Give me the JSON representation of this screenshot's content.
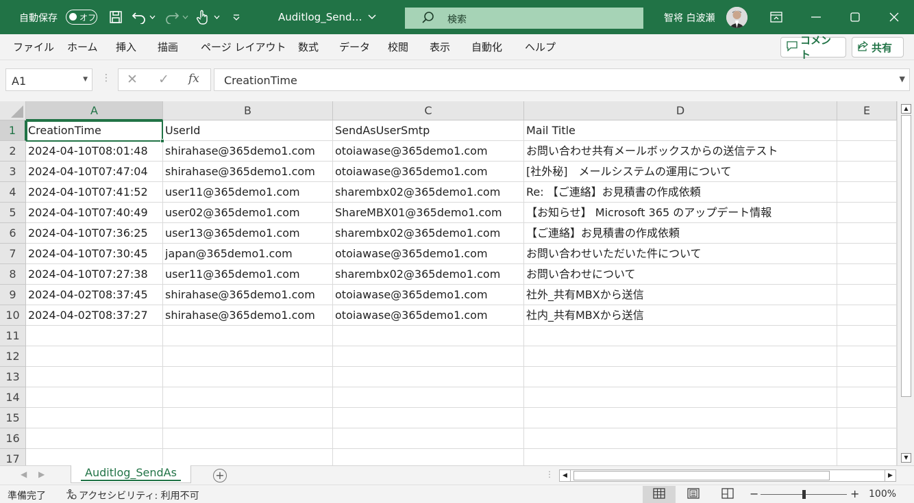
{
  "titlebar": {
    "autosave_label": "自動保存",
    "autosave_state": "オフ",
    "file_title": "Auditlog_Send…",
    "search_placeholder": "検索",
    "user_name": "智将 白波瀬"
  },
  "ribbon": {
    "tabs": [
      "ファイル",
      "ホーム",
      "挿入",
      "描画",
      "ページ レイアウト",
      "数式",
      "データ",
      "校閲",
      "表示",
      "自動化",
      "ヘルプ"
    ],
    "comment_label": "コメント",
    "share_label": "共有"
  },
  "formula_bar": {
    "name_box": "A1",
    "fx_label": "fx",
    "value": "CreationTime"
  },
  "sheet": {
    "columns": [
      "A",
      "B",
      "C",
      "D",
      "E"
    ],
    "row_numbers": [
      "1",
      "2",
      "3",
      "4",
      "5",
      "6",
      "7",
      "8",
      "9",
      "10",
      "11",
      "12",
      "13",
      "14",
      "15",
      "16",
      "17"
    ],
    "rows": [
      [
        "CreationTime",
        "UserId",
        "SendAsUserSmtp",
        "Mail Title"
      ],
      [
        "2024-04-10T08:01:48",
        "shirahase@365demo1.com",
        "otoiawase@365demo1.com",
        "お問い合わせ共有メールボックスからの送信テスト"
      ],
      [
        "2024-04-10T07:47:04",
        "shirahase@365demo1.com",
        "otoiawase@365demo1.com",
        "[社外秘]　メールシステムの運用について"
      ],
      [
        "2024-04-10T07:41:52",
        "user11@365demo1.com",
        "sharembx02@365demo1.com",
        "Re: 【ご連絡】お見積書の作成依頼"
      ],
      [
        "2024-04-10T07:40:49",
        "user02@365demo1.com",
        "ShareMBX01@365demo1.com",
        "【お知らせ】 Microsoft 365 のアップデート情報"
      ],
      [
        "2024-04-10T07:36:25",
        "user13@365demo1.com",
        "sharembx02@365demo1.com",
        "【ご連絡】お見積書の作成依頼"
      ],
      [
        "2024-04-10T07:30:45",
        "japan@365demo1.com",
        "otoiawase@365demo1.com",
        "お問い合わせいただいた件について"
      ],
      [
        "2024-04-10T07:27:38",
        "user11@365demo1.com",
        "sharembx02@365demo1.com",
        "お問い合わせについて"
      ],
      [
        "2024-04-02T08:37:45",
        "shirahase@365demo1.com",
        "otoiawase@365demo1.com",
        "社外_共有MBXから送信"
      ],
      [
        "2024-04-02T08:37:27",
        "shirahase@365demo1.com",
        "otoiawase@365demo1.com",
        "社内_共有MBXから送信"
      ]
    ],
    "selected_cell": "A1"
  },
  "sheet_tabs": {
    "active_tab": "Auditlog_SendAs"
  },
  "statusbar": {
    "ready": "準備完了",
    "accessibility": "アクセシビリティ: 利用不可",
    "zoom": "100%"
  },
  "colors": {
    "accent": "#217346",
    "search_bg": "#a6d3b6"
  }
}
